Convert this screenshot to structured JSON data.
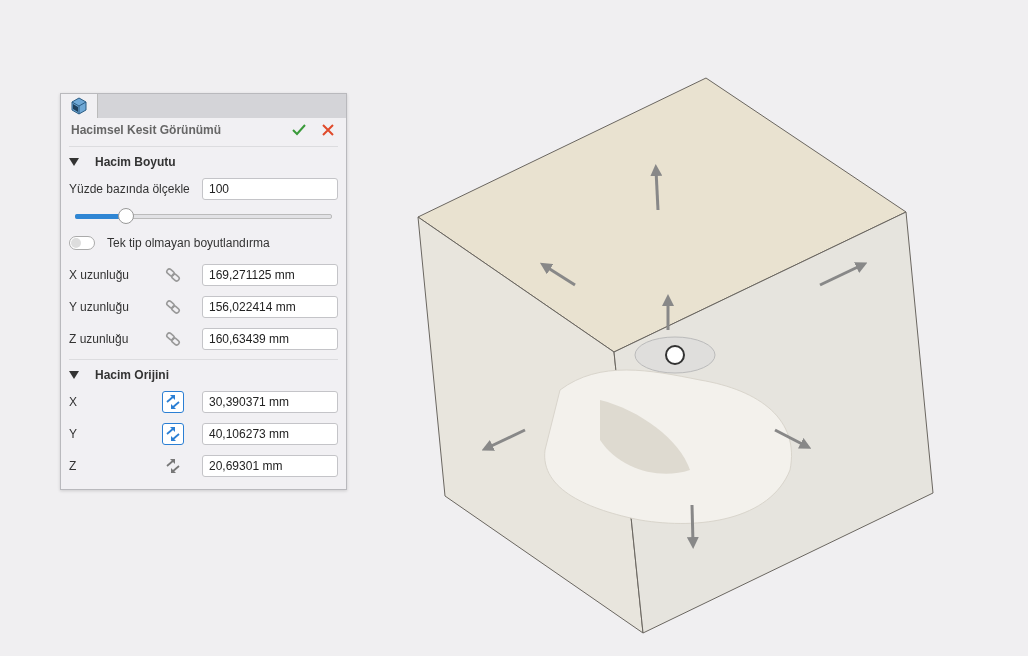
{
  "panel": {
    "title": "Hacimsel Kesit Görünümü",
    "sections": [
      {
        "title": "Hacim Boyutu",
        "expanded": true,
        "kind": "size",
        "scale": {
          "label": "Yüzde bazında ölçekle",
          "value": "100",
          "level": 0.2
        },
        "toggle": {
          "label": "Tek tip olmayan boyutlandırma",
          "on": false
        },
        "rows": [
          {
            "label": "X uzunluğu",
            "value": "169,271125 mm",
            "selected": false
          },
          {
            "label": "Y uzunluğu",
            "value": "156,022414 mm",
            "selected": false
          },
          {
            "label": "Z uzunluğu",
            "value": "160,63439 mm",
            "selected": false
          }
        ]
      },
      {
        "title": "Hacim Orijini",
        "expanded": true,
        "kind": "origin",
        "rows": [
          {
            "label": "X",
            "value": "30,390371 mm",
            "selected": true
          },
          {
            "label": "Y",
            "value": "40,106273 mm",
            "selected": true
          },
          {
            "label": "Z",
            "value": "20,69301 mm",
            "selected": false
          }
        ]
      }
    ]
  }
}
